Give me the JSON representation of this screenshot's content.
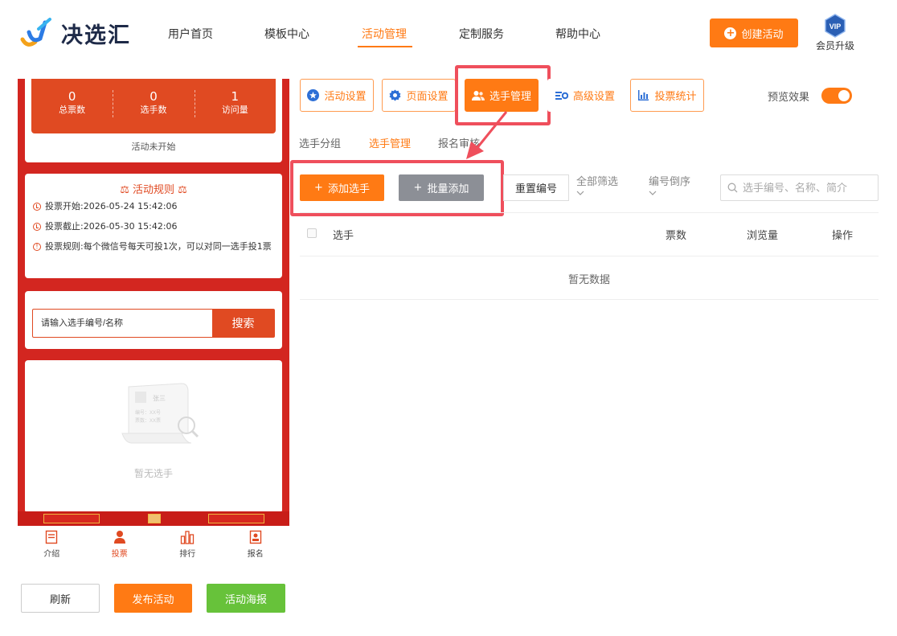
{
  "brand": {
    "name": "决选汇"
  },
  "nav": [
    {
      "label": "用户首页"
    },
    {
      "label": "模板中心"
    },
    {
      "label": "活动管理"
    },
    {
      "label": "定制服务"
    },
    {
      "label": "帮助中心"
    }
  ],
  "header": {
    "create_label": "创建活动",
    "vip_label": "会员升级",
    "vip_badge": "VIP"
  },
  "colors": {
    "accent": "#ff7a14",
    "phone_red": "#d32620",
    "preview_orange": "#e04a22",
    "highlight": "#ef4f5c",
    "poster_green": "#67c23a"
  },
  "preview": {
    "stats": [
      {
        "value": "0",
        "label": "总票数"
      },
      {
        "value": "0",
        "label": "选手数"
      },
      {
        "value": "1",
        "label": "访问量"
      }
    ],
    "status": "活动未开始",
    "rules_title": "活动规则",
    "rules": [
      {
        "label": "投票开始:",
        "value": "2026-05-24 15:42:06"
      },
      {
        "label": "投票截止:",
        "value": "2026-05-30 15:42:06"
      },
      {
        "label": "投票规则:",
        "value": "每个微信号每天可投1次，可以对同一选手投1票"
      }
    ],
    "search_placeholder": "请输入选手编号/名称",
    "search_button": "搜索",
    "empty_illustration": {
      "name": "张三",
      "line1": "编号：XX号",
      "line2": "票数：XX票"
    },
    "empty_text": "暂无选手",
    "tabbar": [
      {
        "label": "介绍",
        "icon": "document-icon"
      },
      {
        "label": "投票",
        "icon": "user-icon"
      },
      {
        "label": "排行",
        "icon": "chart-icon"
      },
      {
        "label": "报名",
        "icon": "signup-icon"
      }
    ]
  },
  "bottom_actions": {
    "refresh": "刷新",
    "publish": "发布活动",
    "poster": "活动海报"
  },
  "toolbar": [
    {
      "label": "活动设置",
      "icon": "star-icon"
    },
    {
      "label": "页面设置",
      "icon": "gear-icon"
    },
    {
      "label": "选手管理",
      "icon": "users-icon"
    },
    {
      "label": "高级设置",
      "icon": "settings-icon"
    },
    {
      "label": "投票统计",
      "icon": "bar-chart-icon"
    }
  ],
  "preview_toggle": {
    "label": "预览效果",
    "on": true
  },
  "subtabs": [
    {
      "label": "选手分组"
    },
    {
      "label": "选手管理"
    },
    {
      "label": "报名审核"
    }
  ],
  "actions": {
    "add_contestant": "添加选手",
    "batch_add": "批量添加",
    "reset_number": "重置编号",
    "filter_all": "全部筛选",
    "sort_desc": "编号倒序",
    "search_placeholder": "选手编号、名称、简介"
  },
  "table": {
    "columns": [
      "选手",
      "票数",
      "浏览量",
      "操作"
    ],
    "empty": "暂无数据"
  }
}
